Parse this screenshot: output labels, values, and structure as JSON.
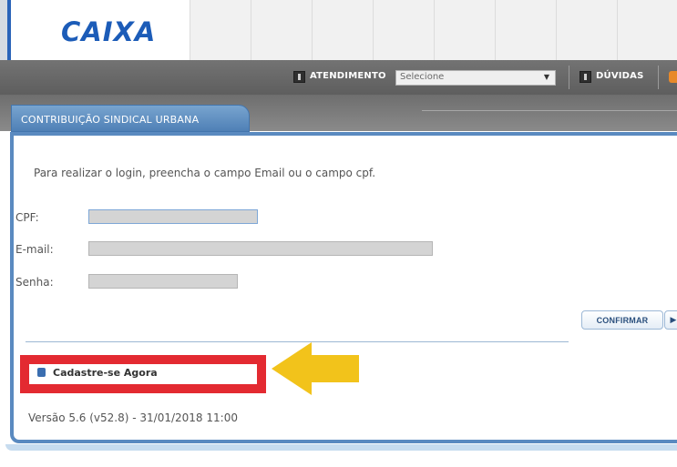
{
  "header": {
    "logo": "CAIXA"
  },
  "toolbar": {
    "atendimento_label": "ATENDIMENTO",
    "atendimento_select": "Selecione",
    "duvidas_label": "DÚVIDAS"
  },
  "tab": {
    "label": "CONTRIBUIÇÃO SINDICAL URBANA"
  },
  "form": {
    "intro": "Para realizar o login, preencha o campo Email ou o campo cpf.",
    "cpf_label": "CPF:",
    "cpf_value": "",
    "email_label": "E-mail:",
    "email_value": "",
    "senha_label": "Senha:",
    "senha_value": "",
    "confirm_label": "CONFIRMAR",
    "next_label": "▶"
  },
  "signup": {
    "label": "Cadastre-se Agora"
  },
  "footer": {
    "version": "Versão 5.6 (v52.8) - 31/01/2018 11:00"
  },
  "colors": {
    "brand_blue": "#1c5cb8",
    "tab_blue": "#5a8ac0",
    "highlight_red": "#e32a31",
    "arrow_yellow": "#f2c31b"
  },
  "icons": {
    "atendimento_icon": "info-square-icon",
    "duvidas_icon": "info-square-icon",
    "signup_icon": "bullet-square-icon",
    "annotation": "arrow-left-icon"
  }
}
